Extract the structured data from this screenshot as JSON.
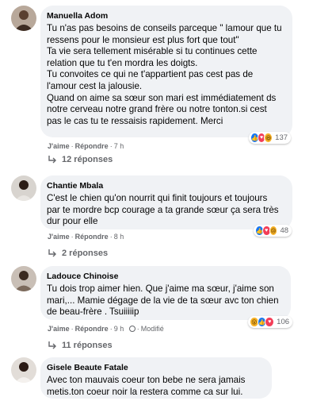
{
  "comments": [
    {
      "author": "Manuella Adom",
      "text": "Tu n'as pas besoins de conseils parceque \" lamour que tu\nressens pour le monsieur est plus fort que tout\"\nTa vie sera tellement misérable si tu continues cette\nrelation que tu t'en mordra les doigts.\nTu convoites ce qui ne t'appartient pas cest pas de\nl'amour cest la jalousie.\nQuand on aime sa sœur son mari est immédiatement ds\nnotre cerveau notre grand frère ou notre tonton.si cest\npas le cas tu te ressaisis rapidement. Merci",
      "like": "J'aime",
      "reply": "Répondre",
      "time": "7 h",
      "reactions": [
        "like",
        "love",
        "haha"
      ],
      "reaction_count": "137",
      "replies": "12 réponses"
    },
    {
      "author": "Chantie Mbala",
      "text": "C'est le chien qu'on nourrit qui finit toujours et toujours\npar te mordre bcp courage a ta grande sœur ça sera très\ndur pour elle",
      "like": "J'aime",
      "reply": "Répondre",
      "time": "8 h",
      "reactions": [
        "like",
        "love",
        "sad"
      ],
      "reaction_count": "48",
      "replies": "2 réponses"
    },
    {
      "author": "Ladouce Chinoise",
      "text": "Tu dois trop aimer hien. Que j'aime ma sœur, j'aime son\nmari,... Mamie dégage de la vie de ta sœur avc ton chien\nde beau-frère . Tsuiiiiip",
      "like": "J'aime",
      "reply": "Répondre",
      "time": "9 h",
      "modified": "Modifié",
      "reactions": [
        "wow",
        "like",
        "love"
      ],
      "reaction_count": "106",
      "replies": "11 réponses"
    },
    {
      "author": "Gisele Beaute Fatale",
      "text": "Avec ton mauvais coeur ton bebe ne sera jamais\nmetis.ton coeur noir la restera comme ca sur lui."
    }
  ],
  "colors": {
    "bubble": "#f0f2f5",
    "meta_text": "#65676b",
    "like_blue": "#1877f2",
    "love_red": "#f33e58",
    "emoji_yellow": "#f7b125"
  }
}
